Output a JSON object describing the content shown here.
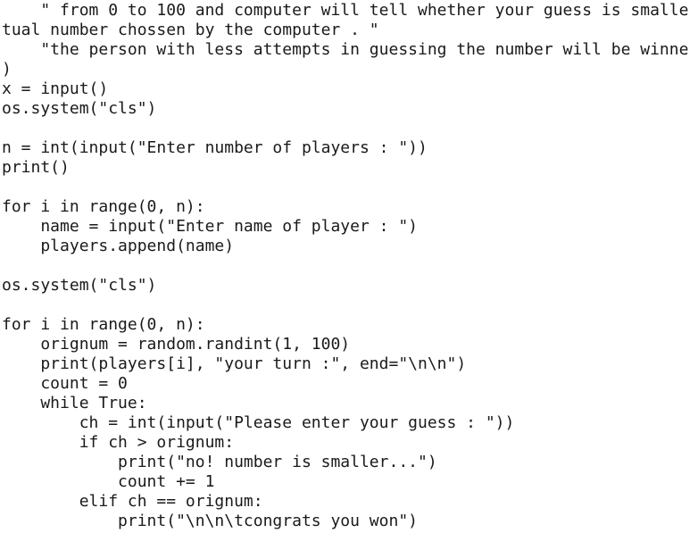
{
  "editor": {
    "lines": [
      "    \" from 0 to 100 and computer will tell whether your guess is smalle",
      "tual number chossen by the computer . \"",
      "    \"the person with less attempts in guessing the number will be winne",
      ")",
      "x = input()",
      "os.system(\"cls\")",
      "",
      "n = int(input(\"Enter number of players : \"))",
      "print()",
      "",
      "for i in range(0, n):",
      "    name = input(\"Enter name of player : \")",
      "    players.append(name)",
      "",
      "os.system(\"cls\")",
      "",
      "for i in range(0, n):",
      "    orignum = random.randint(1, 100)",
      "    print(players[i], \"your turn :\", end=\"\\n\\n\")",
      "    count = 0",
      "    while True:",
      "        ch = int(input(\"Please enter your guess : \"))",
      "        if ch > orignum:",
      "            print(\"no! number is smaller...\")",
      "            count += 1",
      "        elif ch == orignum:",
      "            print(\"\\n\\n\\tcongrats you won\")"
    ]
  }
}
